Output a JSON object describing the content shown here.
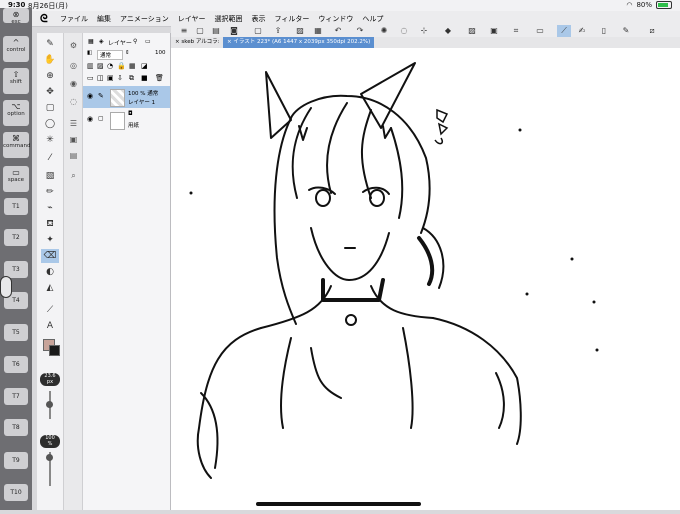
{
  "status": {
    "time": "9:30",
    "date": "8月26日(月)",
    "battery": "80%",
    "battery_level": 0.8
  },
  "menu": {
    "logo": "ᘓ",
    "items": [
      "ファイル",
      "編集",
      "アニメーション",
      "レイヤー",
      "選択範囲",
      "表示",
      "フィルター",
      "ウィンドウ",
      "ヘルプ"
    ]
  },
  "modifier_keys": [
    {
      "label": "esc"
    },
    {
      "label": "control"
    },
    {
      "label": "shift"
    },
    {
      "label": "option"
    },
    {
      "label": "command"
    },
    {
      "label": "space"
    }
  ],
  "tool_keys": [
    "T1",
    "T2",
    "T3",
    "T4",
    "T5",
    "T6",
    "T7",
    "T8",
    "T9",
    "T10"
  ],
  "layer_panel": {
    "tab_label": "レイヤー",
    "blend_mode": "通常",
    "opacity_value": "100",
    "layers": [
      {
        "line1": "100 % 通常",
        "line2": "レイヤー 1",
        "selected": true
      },
      {
        "line1": "",
        "line2": "用紙",
        "selected": false
      }
    ]
  },
  "brush_size": {
    "value": "23.6",
    "unit": "px"
  },
  "brush_opacity": {
    "value": "100",
    "unit": "%"
  },
  "documents": [
    {
      "label": "skeb アルコラ:",
      "active": false
    },
    {
      "label": "イラスト 223* (A6 1447 x 2039px 350dpi 202.2%)",
      "active": true
    }
  ],
  "colors": {
    "accent": "#5b8fd0",
    "main_color": "#c8a49a",
    "sub_color": "#1a1a1a"
  }
}
